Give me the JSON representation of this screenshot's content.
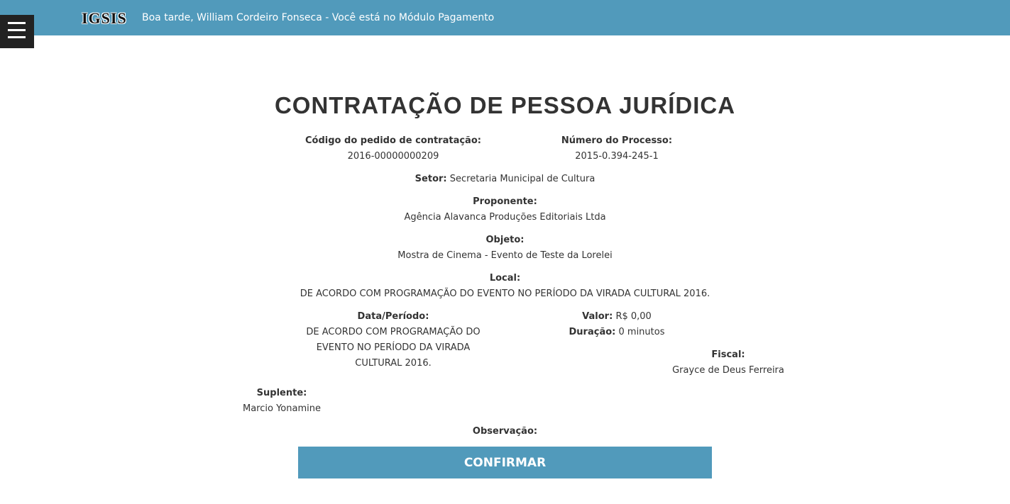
{
  "header": {
    "logo": "IGSIS",
    "welcome": "Boa tarde, William Cordeiro Fonseca - Você está no Módulo Pagamento",
    "background_color": "#519abb",
    "menu_icon": "hamburger-menu-icon"
  },
  "page": {
    "title": "CONTRATAÇÃO DE PESSOA JURÍDICA"
  },
  "fields": {
    "codigo": {
      "label": "Código do pedido de contratação:",
      "value": "2016-00000000209"
    },
    "processo": {
      "label": "Número do Processo:",
      "value": "2015-0.394-245-1"
    },
    "setor": {
      "label": "Setor:",
      "value": "Secretaria Municipal de Cultura"
    },
    "proponente": {
      "label": "Proponente:",
      "value": "Agência Alavanca Produções Editoriais Ltda"
    },
    "objeto": {
      "label": "Objeto:",
      "value": "Mostra de Cinema - Evento de Teste da Lorelei"
    },
    "local": {
      "label": "Local:",
      "value": "DE ACORDO COM PROGRAMAÇÃO DO EVENTO NO PERÍODO DA VIRADA CULTURAL 2016."
    },
    "periodo": {
      "label": "Data/Período:",
      "value": "DE ACORDO COM PROGRAMAÇÃO DO EVENTO NO PERÍODO DA VIRADA CULTURAL 2016."
    },
    "valor": {
      "label": "Valor:",
      "value": "R$ 0,00"
    },
    "duracao": {
      "label": "Duração:",
      "value": "0 minutos"
    },
    "fiscal": {
      "label": "Fiscal:",
      "value": "Grayce de Deus Ferreira"
    },
    "suplente": {
      "label": "Suplente:",
      "value": "Marcio Yonamine"
    },
    "observacao": {
      "label": "Observação:"
    }
  },
  "actions": {
    "confirm_label": "CONFIRMAR",
    "confirm_color": "#519abb"
  }
}
